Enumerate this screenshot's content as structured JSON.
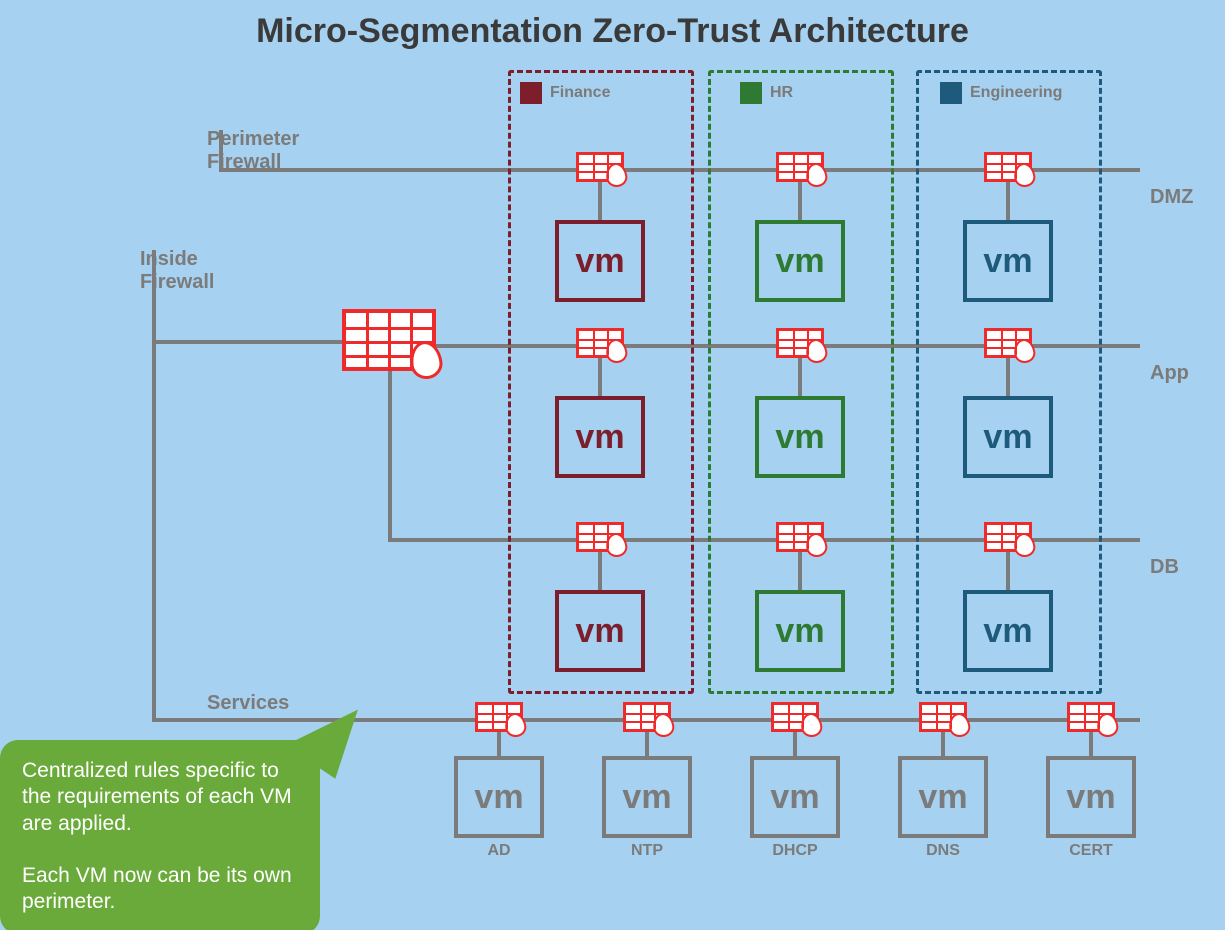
{
  "title": "Micro-Segmentation Zero-Trust Architecture",
  "labels": {
    "perimeter_firewall_l1": "Perimeter",
    "perimeter_firewall_l2": "Firewall",
    "inside_firewall_l1": "Inside",
    "inside_firewall_l2": "Firewall",
    "services": "Services"
  },
  "rows": {
    "dmz": "DMZ",
    "app": "App",
    "db": "DB"
  },
  "groups": {
    "finance": {
      "label": "Finance",
      "color": "#7c1e2b"
    },
    "hr": {
      "label": "HR",
      "color": "#2f7a33"
    },
    "engineering": {
      "label": "Engineering",
      "color": "#1d5a7c"
    }
  },
  "vm_text": "vm",
  "services_row": {
    "ad": "AD",
    "ntp": "NTP",
    "dhcp": "DHCP",
    "dns": "DNS",
    "cert": "CERT"
  },
  "services_color": "#7b7b7b",
  "callout": {
    "p1": "Centralized rules specific to the requirements of each VM are applied.",
    "p2": "Each VM now can be its own perimeter."
  }
}
